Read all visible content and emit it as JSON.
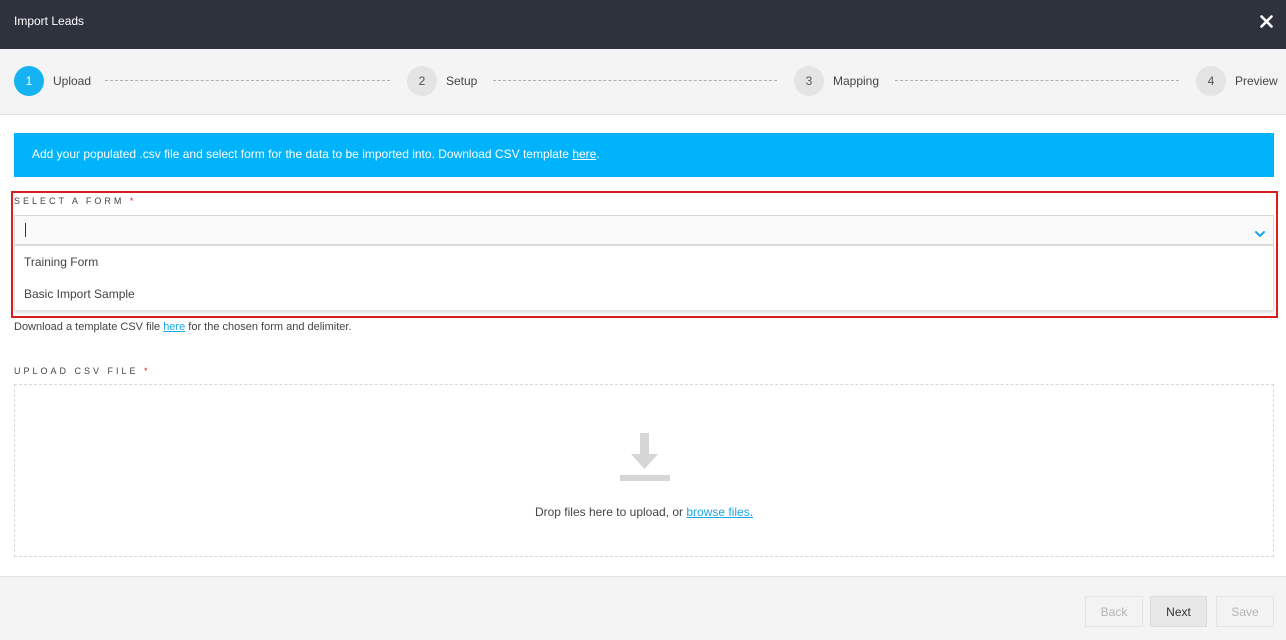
{
  "header": {
    "title": "Import Leads"
  },
  "steps": [
    {
      "num": "1",
      "label": "Upload",
      "active": true
    },
    {
      "num": "2",
      "label": "Setup",
      "active": false
    },
    {
      "num": "3",
      "label": "Mapping",
      "active": false
    },
    {
      "num": "4",
      "label": "Preview",
      "active": false
    }
  ],
  "banner": {
    "text": "Add your populated .csv file and select form for the data to be imported into. Download CSV template ",
    "link": "here",
    "suffix": "."
  },
  "form_select": {
    "label": "SELECT A FORM",
    "required": "*",
    "value": "",
    "options": [
      "Training Form",
      "Basic Import Sample"
    ]
  },
  "hint": {
    "prefix": "Download a template CSV file ",
    "link": "here",
    "suffix": " for the chosen form and delimiter."
  },
  "upload": {
    "label": "UPLOAD CSV FILE",
    "required": "*",
    "text": "Drop files here to upload, or ",
    "link": "browse files."
  },
  "footer": {
    "back": "Back",
    "next": "Next",
    "save": "Save"
  },
  "colors": {
    "accent": "#00b3fa",
    "header_bg": "#2d323c",
    "highlight": "#d91e1e"
  }
}
